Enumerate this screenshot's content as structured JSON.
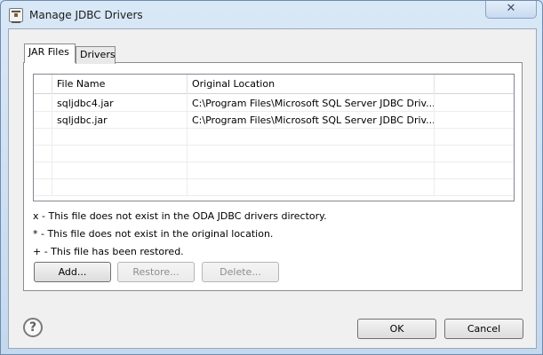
{
  "window": {
    "title": "Manage JDBC Drivers",
    "close_glyph": "✕"
  },
  "tabs": [
    {
      "label": "JAR Files",
      "selected": true
    },
    {
      "label": "Drivers",
      "selected": false
    }
  ],
  "table": {
    "columns": [
      "",
      "File Name",
      "Original Location",
      ""
    ],
    "rows": [
      {
        "flag": "",
        "file": "sqljdbc4.jar",
        "location": "C:\\Program Files\\Microsoft SQL Server JDBC Driv..."
      },
      {
        "flag": "",
        "file": "sqljdbc.jar",
        "location": "C:\\Program Files\\Microsoft SQL Server JDBC Driv..."
      }
    ]
  },
  "legend": [
    "x - This file does not exist in the ODA JDBC drivers directory.",
    "* - This file does not exist in the original location.",
    "+ - This file has been restored."
  ],
  "buttons": {
    "add": "Add...",
    "restore": "Restore...",
    "delete": "Delete...",
    "ok": "OK",
    "cancel": "Cancel"
  },
  "help_glyph": "?"
}
